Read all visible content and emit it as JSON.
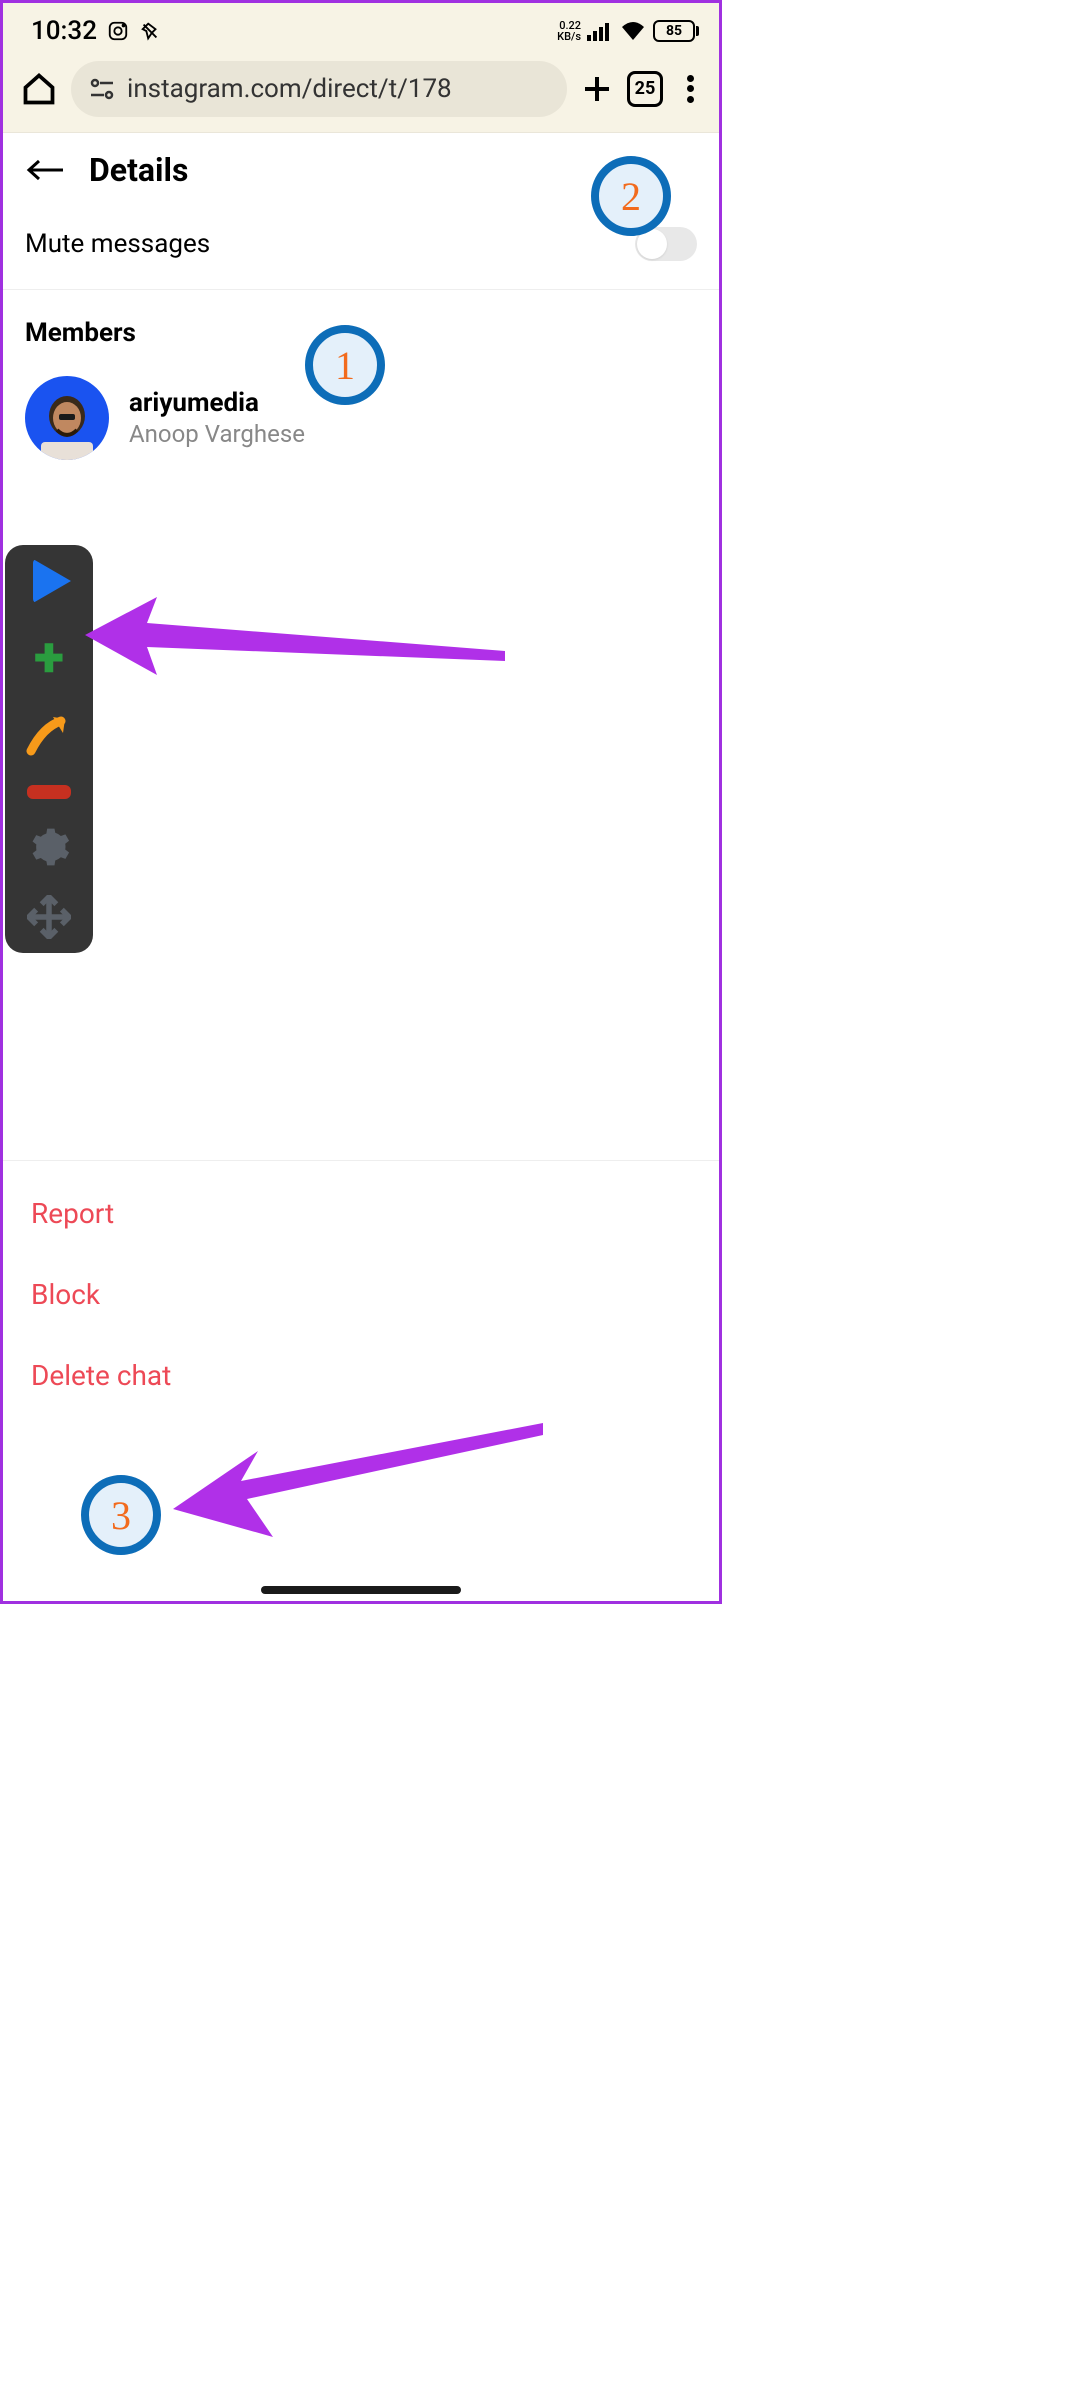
{
  "status": {
    "time": "10:32",
    "kbs_value": "0.22",
    "kbs_label": "KB/s",
    "battery": "85"
  },
  "browser": {
    "url": "instagram.com/direct/t/178",
    "tab_count": "25"
  },
  "page": {
    "title": "Details",
    "mute_label": "Mute messages",
    "members_heading": "Members",
    "member_handle": "ariyumedia",
    "member_name": "Anoop Varghese",
    "report": "Report",
    "block": "Block",
    "delete": "Delete chat"
  },
  "annotations": {
    "a1": "1",
    "a2": "2",
    "a3": "3"
  }
}
